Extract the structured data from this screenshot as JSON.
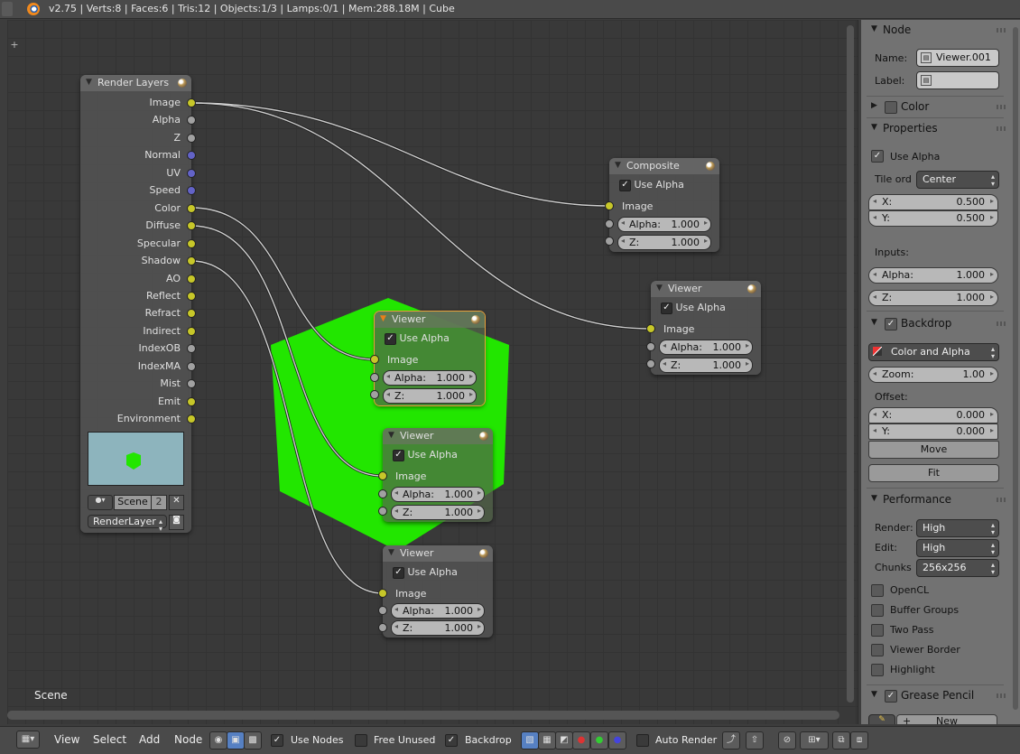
{
  "topbar": {
    "info": "v2.75 | Verts:8 | Faces:6 | Tris:12 | Objects:1/3 | Lamps:0/1 | Mem:288.18M | Cube"
  },
  "editor": {
    "scene_label": "Scene",
    "backdrop_color": "#22e600"
  },
  "render_layers": {
    "title": "Render Layers",
    "outputs": [
      {
        "label": "Image",
        "type": "color"
      },
      {
        "label": "Alpha",
        "type": "value"
      },
      {
        "label": "Z",
        "type": "value"
      },
      {
        "label": "Normal",
        "type": "vector"
      },
      {
        "label": "UV",
        "type": "vector"
      },
      {
        "label": "Speed",
        "type": "vector"
      },
      {
        "label": "Color",
        "type": "color"
      },
      {
        "label": "Diffuse",
        "type": "color"
      },
      {
        "label": "Specular",
        "type": "color"
      },
      {
        "label": "Shadow",
        "type": "color"
      },
      {
        "label": "AO",
        "type": "color"
      },
      {
        "label": "Reflect",
        "type": "color"
      },
      {
        "label": "Refract",
        "type": "color"
      },
      {
        "label": "Indirect",
        "type": "color"
      },
      {
        "label": "IndexOB",
        "type": "value"
      },
      {
        "label": "IndexMA",
        "type": "value"
      },
      {
        "label": "Mist",
        "type": "value"
      },
      {
        "label": "Emit",
        "type": "color"
      },
      {
        "label": "Environment",
        "type": "color"
      }
    ],
    "scene_name": "Scene",
    "scene_users": "2",
    "layer": "RenderLayer"
  },
  "composite": {
    "title": "Composite",
    "use_alpha": "Use Alpha",
    "image": "Image",
    "alpha_label": "Alpha:",
    "alpha": "1.000",
    "z_label": "Z:",
    "z": "1.000"
  },
  "viewers": [
    {
      "title": "Viewer",
      "use_alpha": "Use Alpha",
      "image": "Image",
      "alpha_label": "Alpha:",
      "alpha": "1.000",
      "z_label": "Z:",
      "z": "1.000"
    },
    {
      "title": "Viewer",
      "use_alpha": "Use Alpha",
      "image": "Image",
      "alpha_label": "Alpha:",
      "alpha": "1.000",
      "z_label": "Z:",
      "z": "1.000"
    },
    {
      "title": "Viewer",
      "use_alpha": "Use Alpha",
      "image": "Image",
      "alpha_label": "Alpha:",
      "alpha": "1.000",
      "z_label": "Z:",
      "z": "1.000"
    },
    {
      "title": "Viewer",
      "use_alpha": "Use Alpha",
      "image": "Image",
      "alpha_label": "Alpha:",
      "alpha": "1.000",
      "z_label": "Z:",
      "z": "1.000"
    }
  ],
  "panel": {
    "node": {
      "header": "Node",
      "name_label": "Name:",
      "name": "Viewer.001",
      "label_label": "Label:",
      "label": ""
    },
    "color": {
      "header": "Color"
    },
    "properties": {
      "header": "Properties",
      "use_alpha": "Use Alpha",
      "tile_order_label": "Tile ord",
      "tile_order": "Center",
      "x_label": "X:",
      "x": "0.500",
      "y_label": "Y:",
      "y": "0.500",
      "inputs_label": "Inputs:",
      "alpha_label": "Alpha:",
      "alpha": "1.000",
      "z_label": "Z:",
      "z": "1.000"
    },
    "backdrop": {
      "header": "Backdrop",
      "mode": "Color and Alpha",
      "zoom_label": "Zoom:",
      "zoom": "1.00",
      "offset_label": "Offset:",
      "x_label": "X:",
      "x": "0.000",
      "y_label": "Y:",
      "y": "0.000",
      "move": "Move",
      "fit": "Fit"
    },
    "performance": {
      "header": "Performance",
      "render_label": "Render:",
      "render": "High",
      "edit_label": "Edit:",
      "edit": "High",
      "chunks_label": "Chunks",
      "chunks": "256x256",
      "opencl": "OpenCL",
      "buffer_groups": "Buffer Groups",
      "two_pass": "Two Pass",
      "viewer_border": "Viewer Border",
      "highlight": "Highlight"
    },
    "grease_pencil": {
      "header": "Grease Pencil",
      "new": "New"
    }
  },
  "bottombar": {
    "menus": {
      "view": "View",
      "select": "Select",
      "add": "Add",
      "node": "Node"
    },
    "use_nodes": "Use Nodes",
    "free_unused": "Free Unused",
    "backdrop": "Backdrop",
    "auto_render": "Auto Render"
  }
}
